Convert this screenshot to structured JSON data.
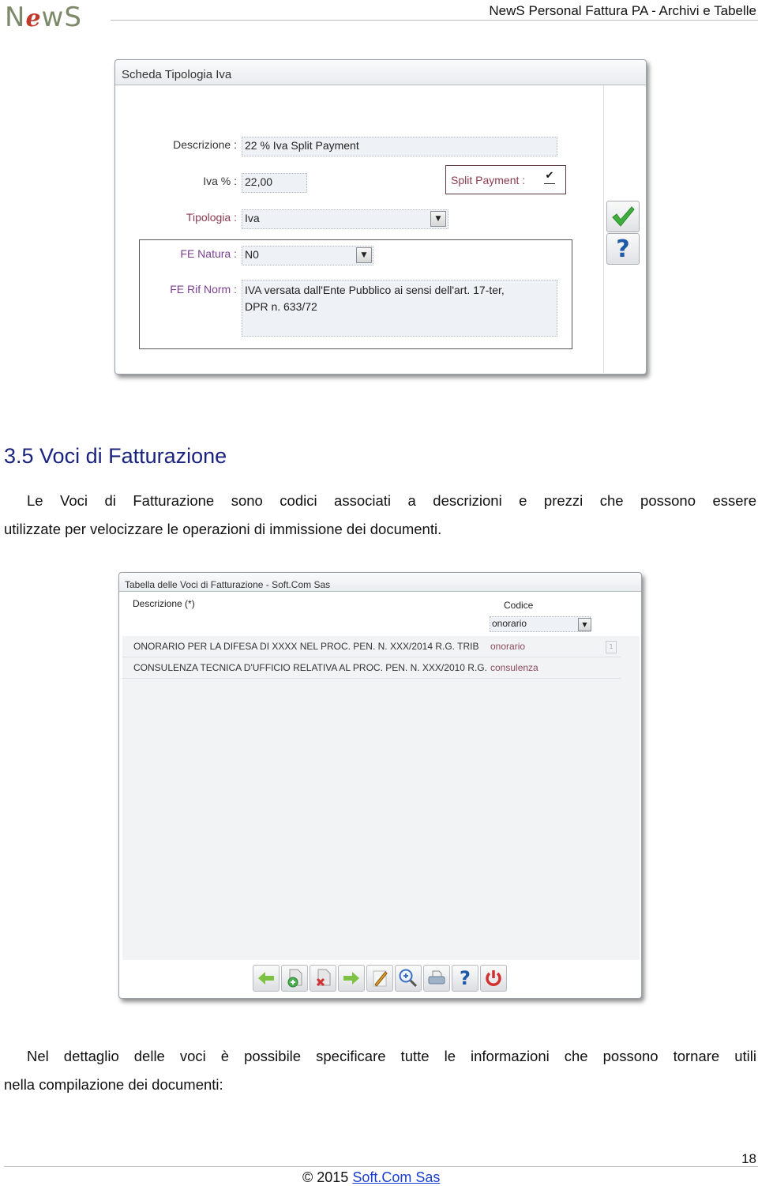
{
  "header": {
    "logo": {
      "pre": "N",
      "accent": "e",
      "post": "wS"
    },
    "title": "NewS Personal Fattura PA -  Archivi e Tabelle"
  },
  "scheda_iva": {
    "window_title": "Scheda Tipologia Iva",
    "fields": {
      "descrizione": {
        "label": "Descrizione :",
        "value": "22 % Iva Split Payment"
      },
      "iva_pct": {
        "label": "Iva % :",
        "value": "22,00"
      },
      "tipologia": {
        "label": "Tipologia :",
        "value": "Iva"
      },
      "split_payment": {
        "label": "Split Payment :",
        "checked": true
      },
      "fe_natura": {
        "label": "FE Natura :",
        "value": "N0"
      },
      "fe_rif_norm": {
        "label": "FE Rif Norm :",
        "value_line1": "IVA versata dall'Ente Pubblico ai sensi dell'art. 17-ter,",
        "value_line2": "DPR n. 633/72"
      }
    },
    "buttons": {
      "confirm_icon": "checkmark-icon",
      "help_icon": "question-icon"
    },
    "colors": {
      "label_dark": "#333333",
      "label_accent": "#8b3a52",
      "label_purple": "#7a3f8f"
    }
  },
  "section": {
    "heading": "3.5 Voci di Fatturazione",
    "intro_line1": "Le Voci di Fatturazione sono codici associati a descrizioni e prezzi che possono essere",
    "intro_line2": "utilizzate per velocizzare le operazioni di immissione dei documenti.",
    "detail_line1": "Nel dettaglio delle voci è possibile specificare tutte le informazioni che possono tornare utili",
    "detail_line2": "nella compilazione dei documenti:"
  },
  "voci_table": {
    "window_title": "Tabella delle Voci di Fatturazione - Soft.Com Sas",
    "columns": {
      "descrizione": "Descrizione (*)",
      "codice": "Codice"
    },
    "codice_filter": "onorario",
    "rows": [
      {
        "descrizione": "ONORARIO PER LA DIFESA DI XXXX NEL PROC. PEN. N. XXX/2014 R.G. TRIB",
        "codice": "onorario"
      },
      {
        "descrizione": "CONSULENZA TECNICA D'UFFICIO RELATIVA AL PROC. PEN. N. XXX/2010 R.G.",
        "codice": "consulenza"
      }
    ],
    "toolbar": [
      "arrow-left-icon",
      "add-document-icon",
      "delete-document-icon",
      "arrow-right-icon",
      "edit-pencil-icon",
      "zoom-icon",
      "print-icon",
      "help-icon",
      "power-icon"
    ]
  },
  "footer": {
    "page_number": "18",
    "copyright": "© 2015 ",
    "link": "Soft.Com Sas"
  }
}
